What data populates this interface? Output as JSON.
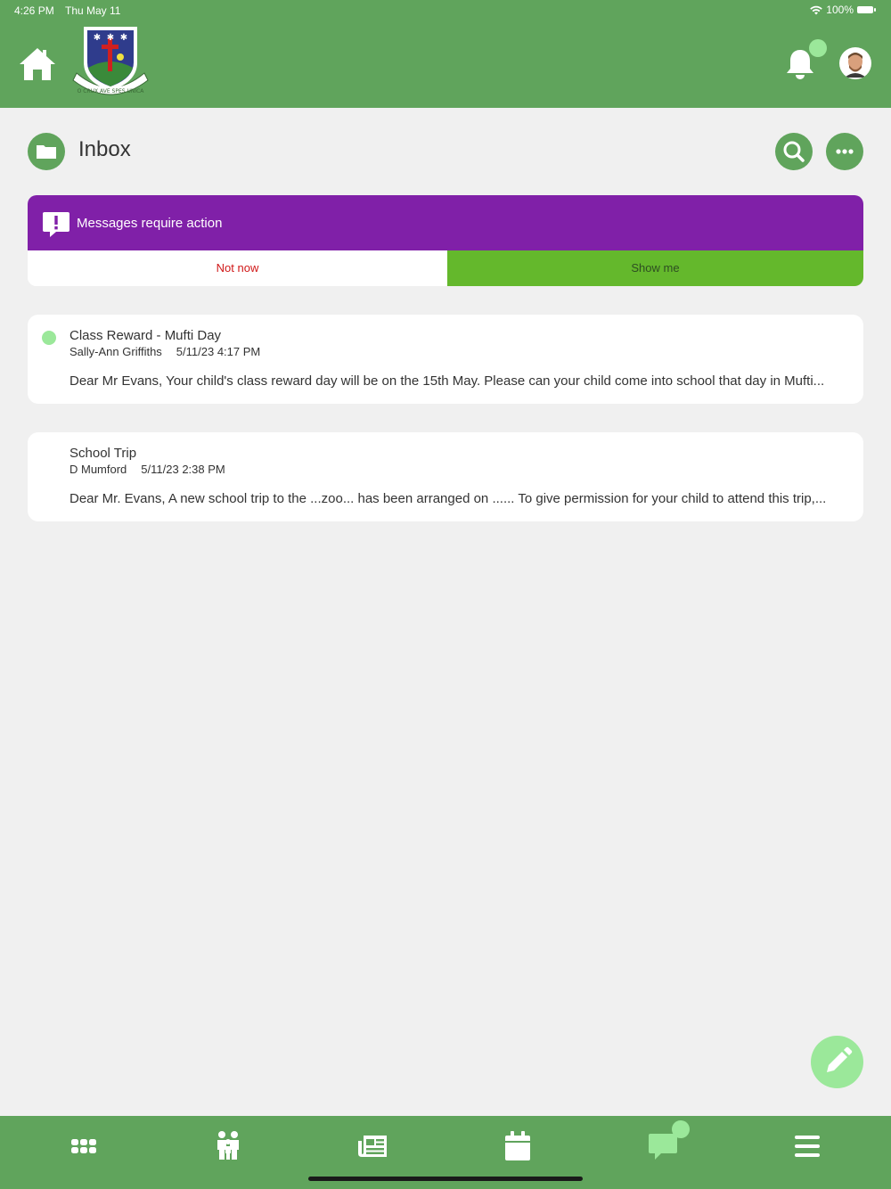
{
  "status_bar": {
    "time": "4:26 PM",
    "date": "Thu May 11",
    "battery": "100%"
  },
  "header": {
    "crest_motto": "O CRUX AVE SPES UNICA",
    "colors": {
      "header": "#60a45c",
      "notification_dot": "#9be89a"
    }
  },
  "page": {
    "title": "Inbox"
  },
  "action_banner": {
    "text": "Messages require action",
    "not_now_label": "Not now",
    "show_me_label": "Show me",
    "colors": {
      "banner": "#8020a8",
      "not_now_text": "#d01818",
      "show_me_bg": "#64b82c"
    }
  },
  "messages": [
    {
      "subject": "Class Reward - Mufti Day",
      "sender": "Sally-Ann Griffiths",
      "date": "5/11/23 4:17 PM",
      "preview": "Dear Mr Evans, Your child's class reward day will be on the 15th May. Please can your child come into school that day in Mufti...",
      "unread": true
    },
    {
      "subject": "School Trip",
      "sender": "D Mumford",
      "date": "5/11/23 2:38 PM",
      "preview": "Dear Mr. Evans, A new school trip to the ...zoo... has been arranged on ...... To give permission for your child to attend this trip,...",
      "unread": false
    }
  ],
  "bottom_nav": {
    "items": [
      "apps-grid-icon",
      "family-icon",
      "news-icon",
      "calendar-icon",
      "chat-icon",
      "menu-icon"
    ],
    "active": "chat-icon"
  }
}
